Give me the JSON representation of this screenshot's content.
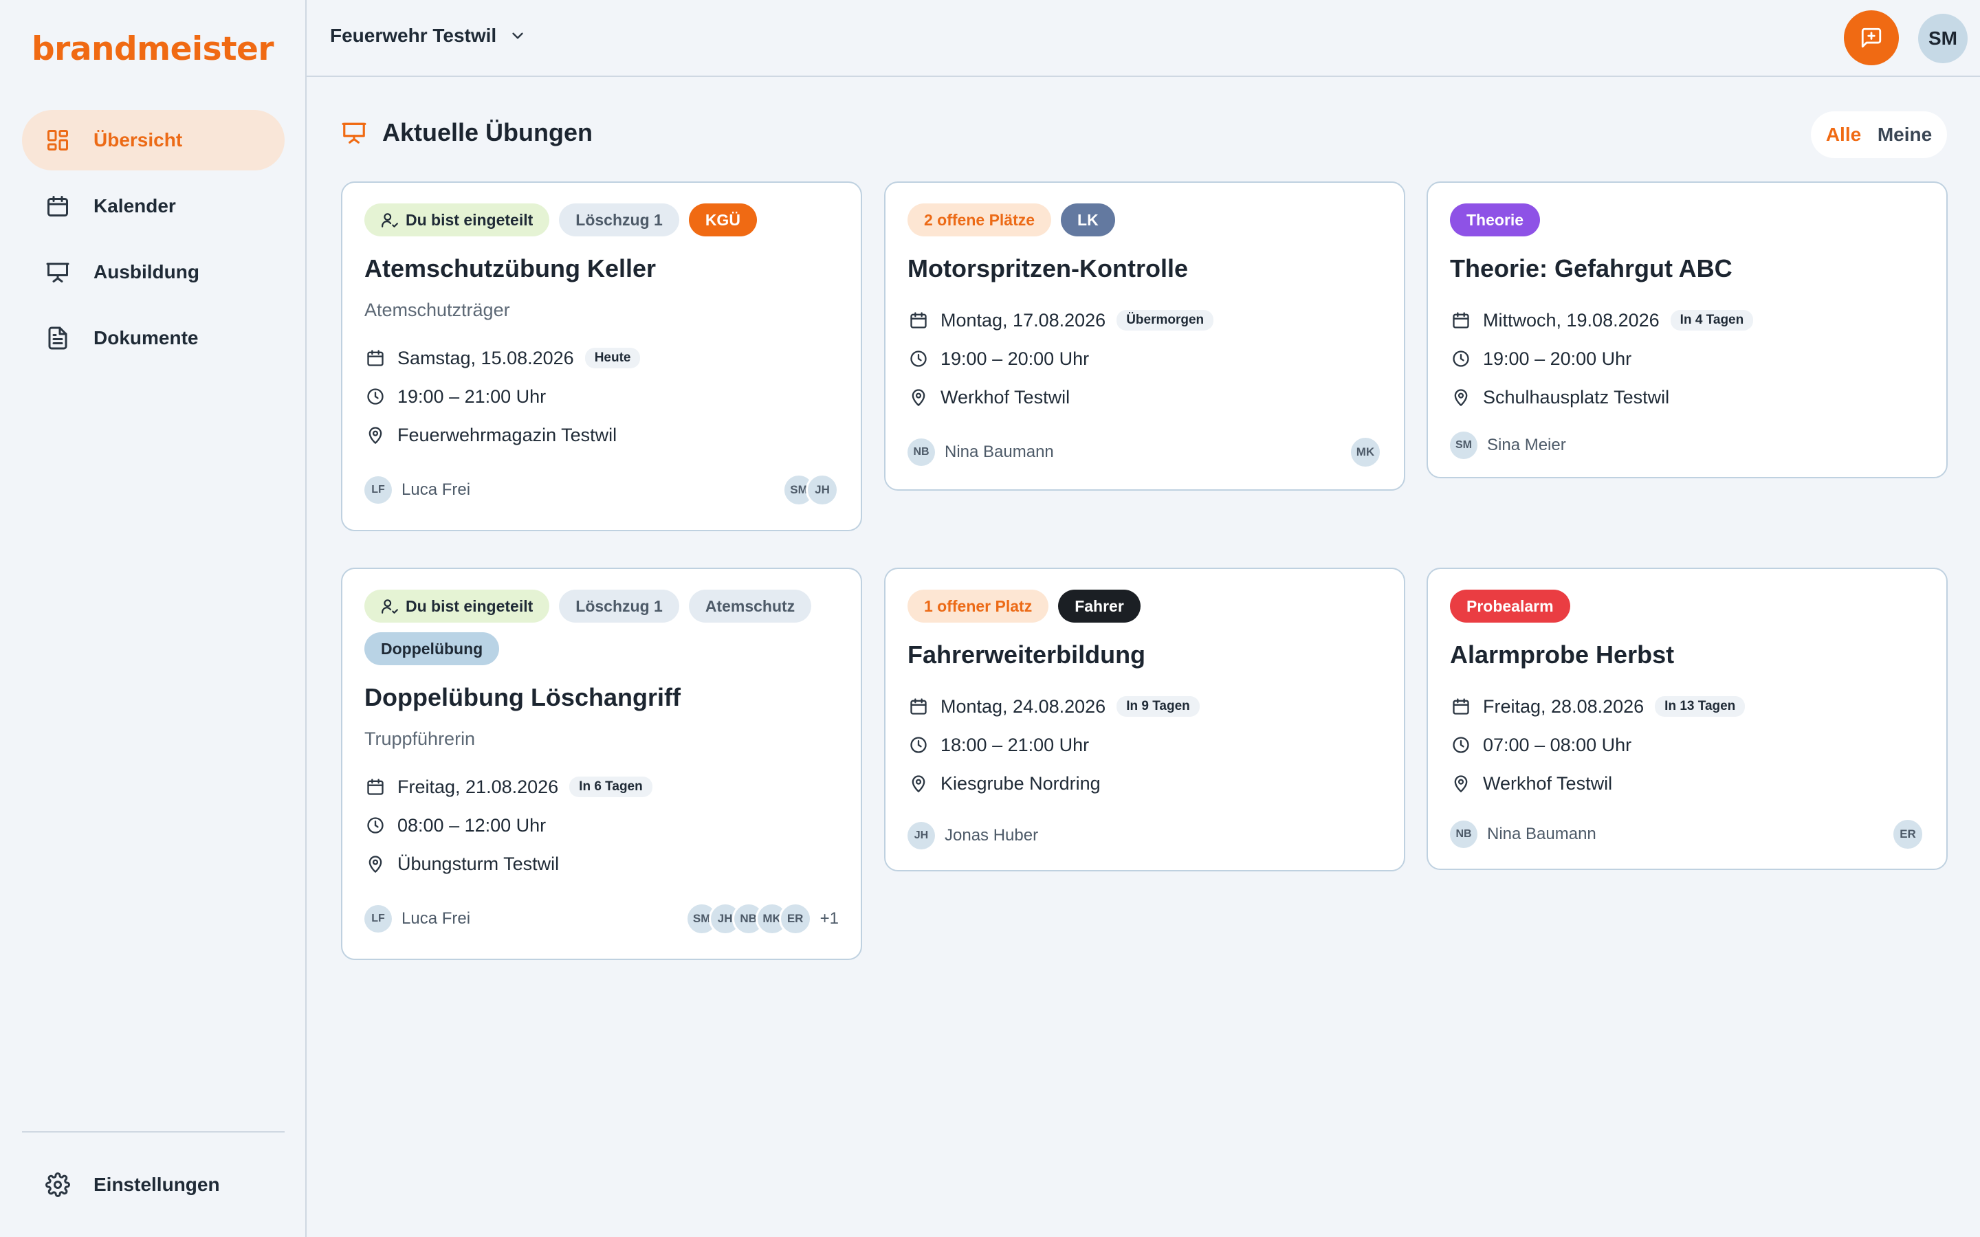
{
  "brand": {
    "logo_text": "brandmeister",
    "accent": "#f06a13"
  },
  "nav": {
    "items": [
      {
        "label": "Übersicht",
        "icon": "dashboard-icon",
        "active": true
      },
      {
        "label": "Kalender",
        "icon": "calendar-icon"
      },
      {
        "label": "Ausbildung",
        "icon": "presentation-icon"
      },
      {
        "label": "Dokumente",
        "icon": "document-icon"
      }
    ],
    "settings_label": "Einstellungen"
  },
  "topbar": {
    "org": "Feuerwehr Testwil",
    "user_initials": "SM"
  },
  "section": {
    "title": "Aktuelle Übungen",
    "filter_all": "Alle",
    "filter_mine": "Meine"
  },
  "cards": [
    {
      "badges": [
        {
          "text": "Du bist eingeteilt",
          "style": "green"
        },
        {
          "text": "Löschzug 1",
          "style": "gray"
        },
        {
          "text": "KGÜ",
          "style": "orange"
        }
      ],
      "title": "Atemschutzübung Keller",
      "subtitle": "Atemschutzträger",
      "date": "Samstag, 15.08.2026",
      "date_chip": "Heute",
      "time": "19:00 – 21:00 Uhr",
      "place": "Feuerwehrmagazin Testwil",
      "leader_initials": "LF",
      "leader": "Luca Frei",
      "avatars": [
        "SM",
        "JH"
      ],
      "more": ""
    },
    {
      "badges": [
        {
          "text": "2 offene Plätze",
          "style": "peach"
        },
        {
          "text": "LK",
          "style": "slate"
        }
      ],
      "title": "Motorspritzen-Kontrolle",
      "subtitle": "",
      "date": "Montag, 17.08.2026",
      "date_chip": "Übermorgen",
      "time": "19:00 – 20:00 Uhr",
      "place": "Werkhof Testwil",
      "leader_initials": "NB",
      "leader": "Nina Baumann",
      "avatars": [
        "MK"
      ],
      "more": ""
    },
    {
      "badges": [
        {
          "text": "Theorie",
          "style": "purple"
        }
      ],
      "title": "Theorie: Gefahrgut ABC",
      "subtitle": "",
      "date": "Mittwoch, 19.08.2026",
      "date_chip": "In 4 Tagen",
      "time": "19:00 – 20:00 Uhr",
      "place": "Schulhausplatz Testwil",
      "leader_initials": "SM",
      "leader": "Sina Meier",
      "avatars": [],
      "more": ""
    },
    {
      "badges": [
        {
          "text": "Du bist eingeteilt",
          "style": "green"
        },
        {
          "text": "Löschzug 1",
          "style": "gray"
        },
        {
          "text": "Atemschutz",
          "style": "gray"
        },
        {
          "text": "Doppelübung",
          "style": "blue"
        }
      ],
      "title": "Doppelübung Löschangriff",
      "subtitle": "Truppführerin",
      "date": "Freitag, 21.08.2026",
      "date_chip": "In 6 Tagen",
      "time": "08:00 – 12:00 Uhr",
      "place": "Übungsturm Testwil",
      "leader_initials": "LF",
      "leader": "Luca Frei",
      "avatars": [
        "SM",
        "JH",
        "NB",
        "MK",
        "ER"
      ],
      "more": "+1"
    },
    {
      "badges": [
        {
          "text": "1 offener Platz",
          "style": "peach"
        },
        {
          "text": "Fahrer",
          "style": "black"
        }
      ],
      "title": "Fahrerweiterbildung",
      "subtitle": "",
      "date": "Montag, 24.08.2026",
      "date_chip": "In 9 Tagen",
      "time": "18:00 – 21:00 Uhr",
      "place": "Kiesgrube Nordring",
      "leader_initials": "JH",
      "leader": "Jonas Huber",
      "avatars": [],
      "more": ""
    },
    {
      "badges": [
        {
          "text": "Probealarm",
          "style": "red"
        }
      ],
      "title": "Alarmprobe Herbst",
      "subtitle": "",
      "date": "Freitag, 28.08.2026",
      "date_chip": "In 13 Tagen",
      "time": "07:00 – 08:00 Uhr",
      "place": "Werkhof Testwil",
      "leader_initials": "NB",
      "leader": "Nina Baumann",
      "avatars": [
        "ER"
      ],
      "more": ""
    }
  ]
}
